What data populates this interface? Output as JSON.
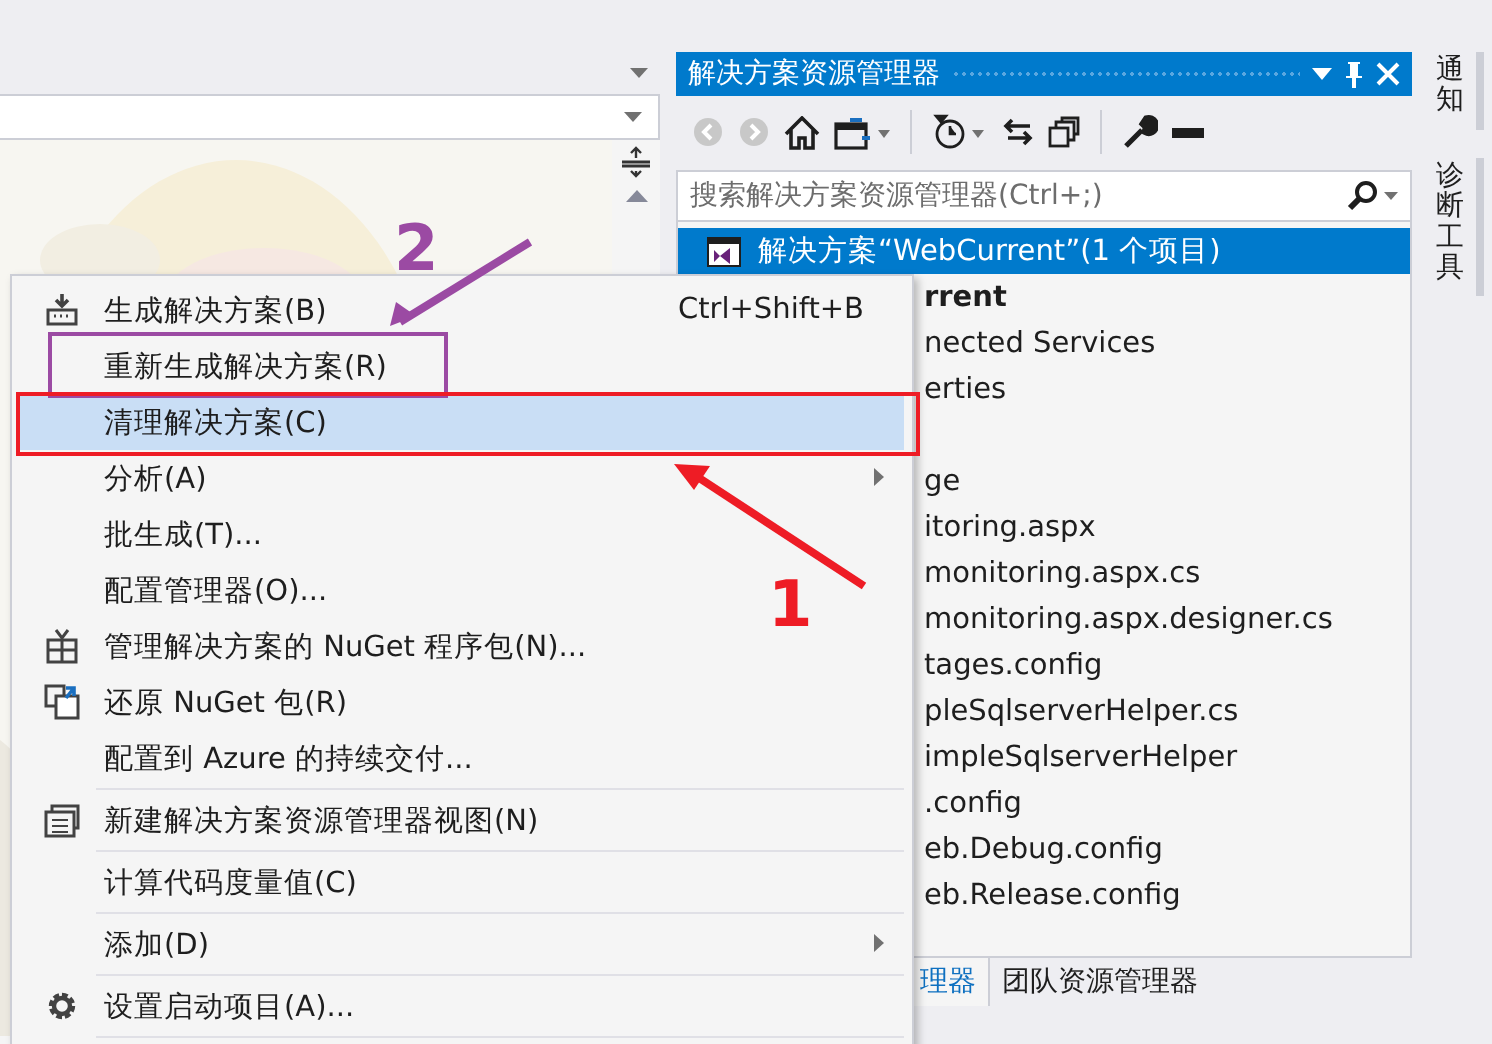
{
  "explorer": {
    "title": "解决方案资源管理器",
    "search": {
      "placeholder": "搜索解决方案资源管理器(Ctrl+;)"
    },
    "tree": [
      {
        "label": "解决方案“WebCurrent”(1 个项目)",
        "selected": true,
        "bold": false,
        "children": [
          {
            "label": "rrent",
            "selected": false,
            "bold": true,
            "children": [
              {
                "label": "nected Services",
                "selected": false,
                "bold": false
              },
              {
                "label": "erties",
                "selected": false,
                "bold": false
              },
              {
                "label": "ge",
                "selected": false,
                "bold": false
              },
              {
                "label": "itoring.aspx",
                "selected": false,
                "bold": false
              },
              {
                "label": "monitoring.aspx.cs",
                "selected": false,
                "bold": false
              },
              {
                "label": "monitoring.aspx.designer.cs",
                "selected": false,
                "bold": false
              },
              {
                "label": "tages.config",
                "selected": false,
                "bold": false
              },
              {
                "label": "pleSqlserverHelper.cs",
                "selected": false,
                "bold": false
              },
              {
                "label": "impleSqlserverHelper",
                "selected": false,
                "bold": false
              },
              {
                "label": ".config",
                "selected": false,
                "bold": false
              },
              {
                "label": "eb.Debug.config",
                "selected": false,
                "bold": false
              },
              {
                "label": "eb.Release.config",
                "selected": false,
                "bold": false
              }
            ]
          }
        ]
      }
    ],
    "bottom_tabs": [
      {
        "label": "理器",
        "selected": true
      },
      {
        "label": "团队资源管理器",
        "selected": false
      }
    ]
  },
  "side_tabs": [
    {
      "label": "通知"
    },
    {
      "label": "诊断工具"
    }
  ],
  "context_menu": [
    {
      "kind": "command",
      "label": "生成解决方案(B)",
      "shortcut": "Ctrl+Shift+B",
      "selected": false
    },
    {
      "kind": "command",
      "label": "重新生成解决方案(R)",
      "selected": false
    },
    {
      "kind": "command",
      "label": "清理解决方案(C)",
      "selected": true
    },
    {
      "kind": "submenu",
      "label": "分析(A)",
      "selected": false
    },
    {
      "kind": "command",
      "label": "批生成(T)...",
      "selected": false
    },
    {
      "kind": "command",
      "label": "配置管理器(O)...",
      "selected": false
    },
    {
      "kind": "command",
      "label": "管理解决方案的 NuGet 程序包(N)...",
      "selected": false
    },
    {
      "kind": "command",
      "label": "还原 NuGet 包(R)",
      "selected": false
    },
    {
      "kind": "command",
      "label": "配置到 Azure 的持续交付...",
      "selected": false
    },
    {
      "kind": "separator"
    },
    {
      "kind": "command",
      "label": "新建解决方案资源管理器视图(N)",
      "selected": false
    },
    {
      "kind": "separator"
    },
    {
      "kind": "command",
      "label": "计算代码度量值(C)",
      "selected": false
    },
    {
      "kind": "separator"
    },
    {
      "kind": "submenu",
      "label": "添加(D)",
      "selected": false
    },
    {
      "kind": "separator"
    },
    {
      "kind": "command",
      "label": "设置启动项目(A)...",
      "selected": false
    },
    {
      "kind": "separator"
    }
  ],
  "annotations": [
    {
      "number": "2",
      "color": "#9b4aa3"
    },
    {
      "number": "1",
      "color": "#ee1c25"
    }
  ]
}
